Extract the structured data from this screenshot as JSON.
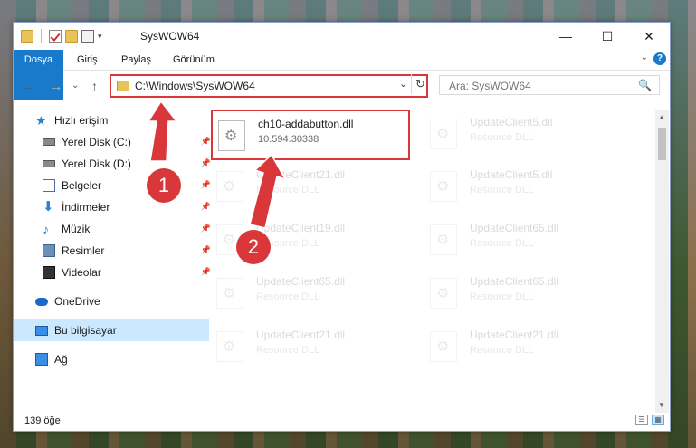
{
  "window": {
    "title": "SysWOW64"
  },
  "window_controls": {
    "minimize": "—",
    "maximize": "☐",
    "close": "✕"
  },
  "ribbon": {
    "tabs": [
      "Dosya",
      "Giriş",
      "Paylaş",
      "Görünüm"
    ],
    "help": "?",
    "collapse": "⌄"
  },
  "nav": {
    "back": "←",
    "forward": "→",
    "history": "⌄",
    "up": "↑",
    "address": "C:\\Windows\\SysWOW64",
    "address_dropdown": "⌄",
    "refresh": "↻",
    "search_placeholder": "Ara: SysWOW64",
    "search_icon": "🔍"
  },
  "sidebar": {
    "items": [
      {
        "label": "Hızlı erişim",
        "icon": "star-icon"
      },
      {
        "label": "Yerel Disk (C:)",
        "icon": "disk-icon",
        "pinned": true
      },
      {
        "label": "Yerel Disk (D:)",
        "icon": "disk-icon",
        "pinned": true
      },
      {
        "label": "Belgeler",
        "icon": "document-icon",
        "pinned": true
      },
      {
        "label": "İndirmeler",
        "icon": "download-icon",
        "pinned": true
      },
      {
        "label": "Müzik",
        "icon": "music-icon",
        "pinned": true
      },
      {
        "label": "Resimler",
        "icon": "pictures-icon",
        "pinned": true
      },
      {
        "label": "Videolar",
        "icon": "videos-icon",
        "pinned": true
      },
      {
        "label": "OneDrive",
        "icon": "cloud-icon"
      },
      {
        "label": "Bu bilgisayar",
        "icon": "computer-icon",
        "selected": true
      },
      {
        "label": "Ağ",
        "icon": "network-icon"
      }
    ],
    "pin_glyph": "📌"
  },
  "files": [
    {
      "name": "ch10-addabutton.dll",
      "sub": "10.594.30338",
      "highlight": true
    },
    {
      "name": "UpdateClient5.dll",
      "sub": "Resource DLL"
    },
    {
      "name": "UpdateClient21.dll",
      "sub": "Resource DLL"
    },
    {
      "name": "UpdateClient5.dll",
      "sub": "Resource DLL"
    },
    {
      "name": "UpdateClient19.dll",
      "sub": "Resource DLL"
    },
    {
      "name": "UpdateClient65.dll",
      "sub": "Resource DLL"
    },
    {
      "name": "UpdateClient65.dll",
      "sub": "Resource DLL"
    },
    {
      "name": "UpdateClient65.dll",
      "sub": "Resource DLL"
    },
    {
      "name": "UpdateClient21.dll",
      "sub": "Resource DLL"
    },
    {
      "name": "UpdateClient21.dll",
      "sub": "Resource DLL"
    }
  ],
  "annotations": {
    "step1": "1",
    "step2": "2"
  },
  "status": {
    "count": "139 öğe"
  },
  "view_buttons": {
    "details": "☰",
    "tiles": "▦"
  },
  "scroll": {
    "up": "▲",
    "down": "▼"
  },
  "colors": {
    "accent": "#1979ca",
    "highlight": "#d9373a",
    "selected": "#cce8ff"
  }
}
